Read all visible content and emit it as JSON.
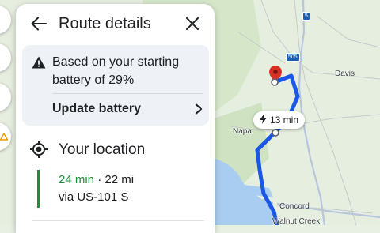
{
  "map": {
    "labels": {
      "davis": "Davis",
      "napa": "Napa",
      "concord": "Concord",
      "walnut_creek": "Walnut Creek"
    },
    "shields": {
      "i5": "5",
      "i505": "505"
    },
    "callout": {
      "icon": "bolt-icon",
      "eta": "13 min"
    },
    "route_color": "#1a56e8"
  },
  "panel": {
    "title": "Route details",
    "back_icon": "arrow-left-icon",
    "close_icon": "close-icon",
    "warning": {
      "icon": "warning-icon",
      "text": "Based on your starting battery of 29%",
      "action_label": "Update battery",
      "action_icon": "chevron-right-icon"
    },
    "origin": {
      "icon": "my-location-icon",
      "label": "Your location"
    },
    "leg": {
      "duration": "24 min",
      "separator": " · ",
      "distance": "22 mi",
      "via": "via US-101 S",
      "accent_color": "#1e8e3e"
    }
  }
}
